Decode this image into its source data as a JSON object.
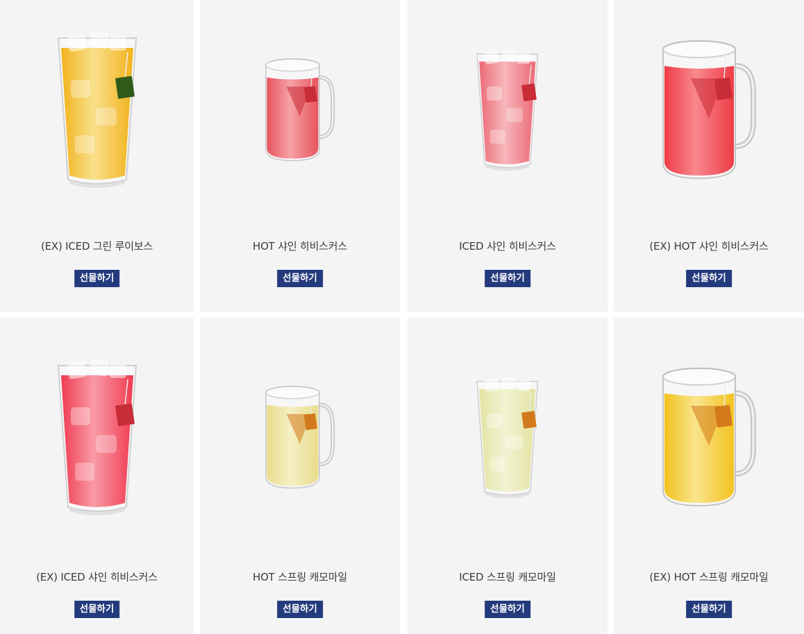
{
  "products": [
    {
      "name": "(EX) ICED 그린 루이보스",
      "gift_label": "선물하기",
      "icon": "iced-tea-glass-icon",
      "liquid": "#f2b21c",
      "liquid_light": "#f8e08a",
      "tag": "#2f5a18",
      "kind": "iced"
    },
    {
      "name": "HOT 샤인 히비스커스",
      "gift_label": "선물하기",
      "icon": "hot-tea-mug-icon",
      "liquid": "#e8545e",
      "liquid_light": "#f5a2a6",
      "tag": "#c82c36",
      "kind": "hot-small"
    },
    {
      "name": "ICED 샤인 히비스커스",
      "gift_label": "선물하기",
      "icon": "iced-tea-glass-icon",
      "liquid": "#ec6a76",
      "liquid_light": "#f6b6bb",
      "tag": "#c82c36",
      "kind": "iced-small"
    },
    {
      "name": "(EX) HOT 샤인 히비스커스",
      "gift_label": "선물하기",
      "icon": "hot-tea-mug-icon",
      "liquid": "#ee3c46",
      "liquid_light": "#f8888e",
      "tag": "#c82c36",
      "kind": "hot"
    },
    {
      "name": "(EX) ICED 샤인 히비스커스",
      "gift_label": "선물하기",
      "icon": "iced-tea-glass-icon",
      "liquid": "#f03c52",
      "liquid_light": "#f99aa6",
      "tag": "#c82c36",
      "kind": "iced"
    },
    {
      "name": "HOT 스프링 캐모마일",
      "gift_label": "선물하기",
      "icon": "hot-tea-mug-icon",
      "liquid": "#e9dc8c",
      "liquid_light": "#f5efc4",
      "tag": "#d37a1c",
      "kind": "hot-small"
    },
    {
      "name": "ICED 스프링 캐모마일",
      "gift_label": "선물하기",
      "icon": "iced-tea-glass-icon",
      "liquid": "#e3e3a2",
      "liquid_light": "#f3f3d4",
      "tag": "#d37a1c",
      "kind": "iced-small"
    },
    {
      "name": "(EX) HOT 스프링 캐모마일",
      "gift_label": "선물하기",
      "icon": "hot-tea-mug-icon",
      "liquid": "#f2c21e",
      "liquid_light": "#f9e48c",
      "tag": "#d37a1c",
      "kind": "hot"
    }
  ]
}
